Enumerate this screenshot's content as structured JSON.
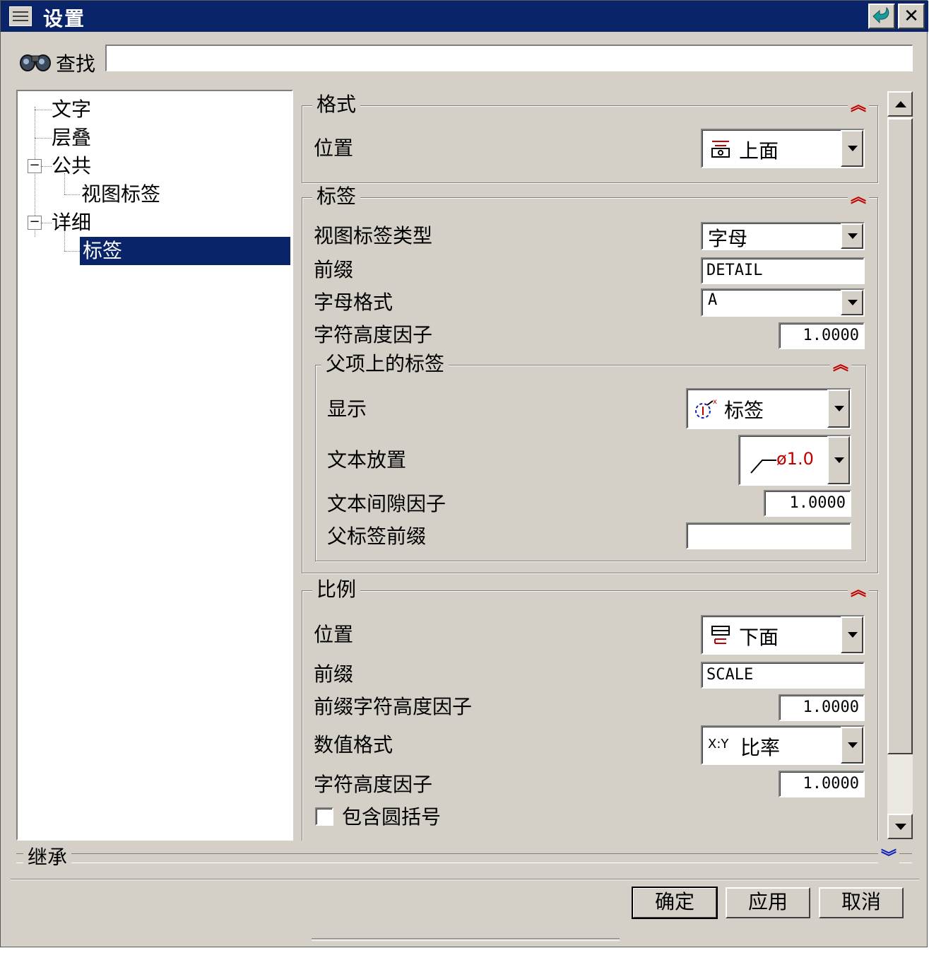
{
  "window": {
    "title": "设置"
  },
  "search": {
    "label": "查找",
    "value": ""
  },
  "tree": {
    "items": [
      {
        "label": "文字"
      },
      {
        "label": "层叠"
      },
      {
        "label": "公共"
      },
      {
        "label": "视图标签"
      },
      {
        "label": "详细"
      },
      {
        "label": "标签",
        "selected": true
      }
    ]
  },
  "format_group": {
    "title": "格式",
    "position_label": "位置",
    "position_value": "上面"
  },
  "label_group": {
    "title": "标签",
    "view_label_type_label": "视图标签类型",
    "view_label_type_value": "字母",
    "prefix_label": "前缀",
    "prefix_value": "DETAIL",
    "letter_format_label": "字母格式",
    "letter_format_value": "A",
    "char_height_label": "字符高度因子",
    "char_height_value": "1.0000",
    "parent": {
      "title": "父项上的标签",
      "display_label": "显示",
      "display_value": "标签",
      "text_placement_label": "文本放置",
      "text_placement_value": "ø1.0",
      "text_gap_label": "文本间隙因子",
      "text_gap_value": "1.0000",
      "parent_prefix_label": "父标签前缀",
      "parent_prefix_value": ""
    }
  },
  "scale_group": {
    "title": "比例",
    "position_label": "位置",
    "position_value": "下面",
    "prefix_label": "前缀",
    "prefix_value": "SCALE",
    "prefix_height_label": "前缀字符高度因子",
    "prefix_height_value": "1.0000",
    "value_format_label": "数值格式",
    "value_format_icon": "X:Y",
    "value_format_value": "比率",
    "char_height_label": "字符高度因子",
    "char_height_value": "1.0000",
    "include_parens_label": "包含圆括号",
    "include_parens_checked": false
  },
  "inherit": {
    "label": "继承"
  },
  "buttons": {
    "ok": "确定",
    "apply": "应用",
    "cancel": "取消"
  },
  "colors": {
    "title_bar": "#0a246a",
    "face": "#d4d0c8",
    "collapse_arrow": "#c00000",
    "expand_arrow": "#1020c0"
  }
}
